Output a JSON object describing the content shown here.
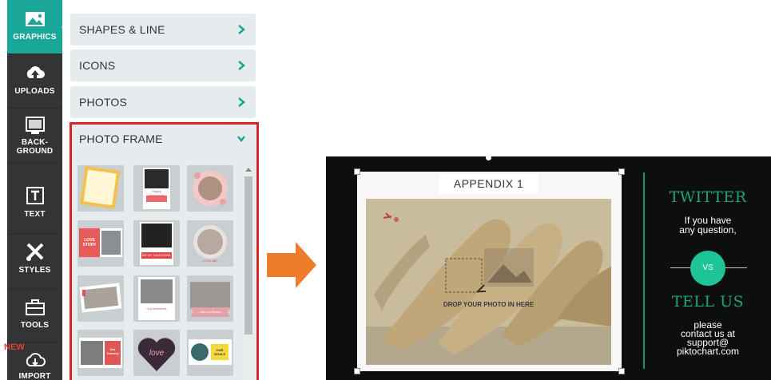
{
  "rail": {
    "items": [
      {
        "label": "GRAPHICS",
        "icon": "image-icon"
      },
      {
        "label": "UPLOADS",
        "icon": "cloud-upload-icon"
      },
      {
        "label_line1": "BACK-",
        "label_line2": "GROUND",
        "icon": "background-monitor-icon"
      },
      {
        "label": "TEXT",
        "icon": "text-icon"
      },
      {
        "label": "STYLES",
        "icon": "styles-tools-icon"
      },
      {
        "label": "TOOLS",
        "icon": "toolbox-icon"
      },
      {
        "label": "IMPORT",
        "icon": "cloud-import-icon",
        "badge": "NEW"
      }
    ],
    "active_color": "#1aa79a"
  },
  "panel": {
    "categories": [
      {
        "label": "SHAPES & LINE",
        "state": "collapsed"
      },
      {
        "label": "ICONS",
        "state": "collapsed"
      },
      {
        "label": "PHOTOS",
        "state": "collapsed"
      },
      {
        "label": "PHOTO FRAME",
        "state": "expanded"
      }
    ],
    "thumbnails": [
      {
        "text": ""
      },
      {
        "text": "Happy Anniversary"
      },
      {
        "text": ""
      },
      {
        "text": "LOVE STORY"
      },
      {
        "text": "BE MY VALENTINE"
      },
      {
        "text": "LOVE ME"
      },
      {
        "text": ""
      },
      {
        "text": "Our Memories"
      },
      {
        "text": "Like our Bonds"
      },
      {
        "text": "Our Journey"
      },
      {
        "text": "love"
      },
      {
        "text": "OUR GOALS"
      }
    ],
    "highlight_color": "#d8232a"
  },
  "canvas": {
    "frame_title": "APPENDIX 1",
    "drop_text": "DROP YOUR PHOTO IN HERE",
    "twitter_title": "TWITTER",
    "twitter_lines": [
      "If you have",
      "any question,"
    ],
    "vs_label": "VS",
    "tell_title": "TELL US",
    "tell_lines": [
      "please",
      "contact us at",
      "support@",
      "piktochart.com"
    ],
    "accent_color": "#1ec497"
  }
}
